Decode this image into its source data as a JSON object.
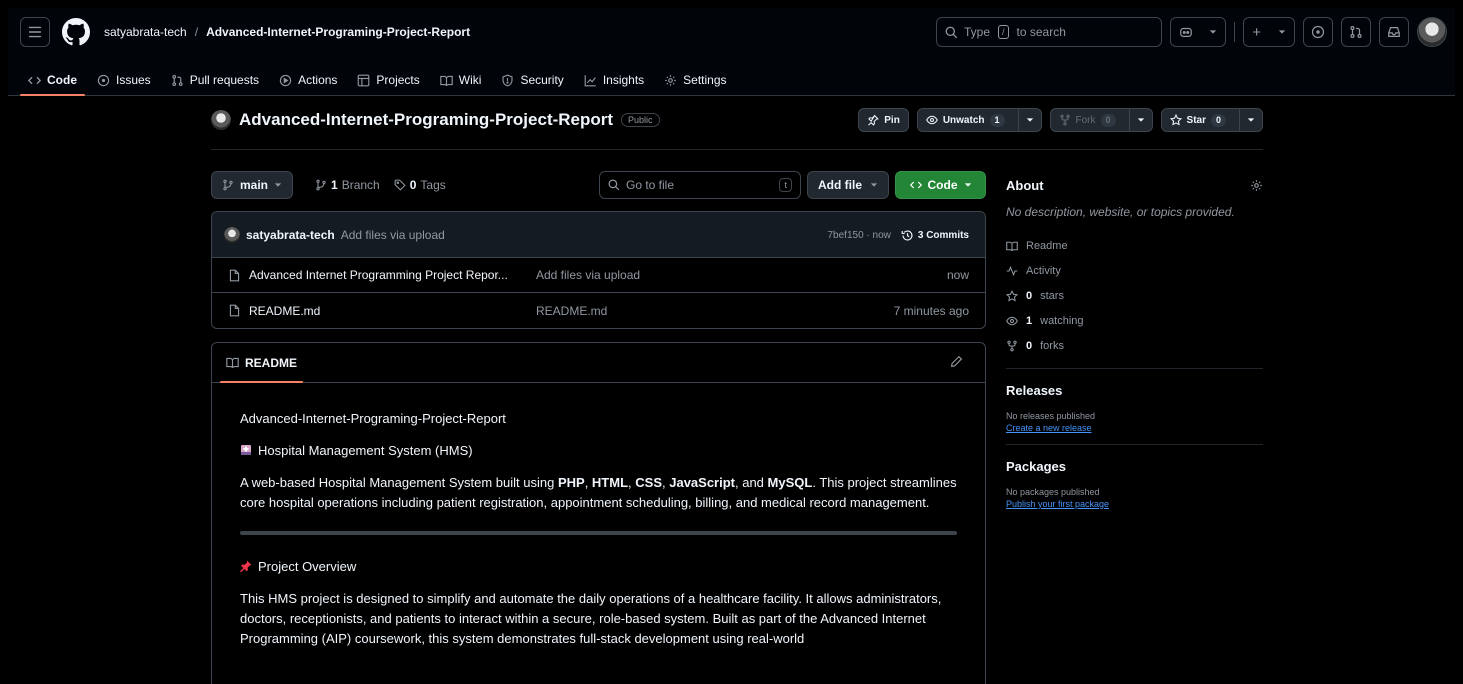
{
  "header": {
    "owner": "satyabrata-tech",
    "separator": "/",
    "repo": "Advanced-Internet-Programing-Project-Report",
    "search_prefix": "Type",
    "search_key": "/",
    "search_suffix": "to search",
    "plus_label": "+"
  },
  "nav_tabs": [
    {
      "label": "Code",
      "icon": "code-icon",
      "active": true
    },
    {
      "label": "Issues",
      "icon": "issue-icon"
    },
    {
      "label": "Pull requests",
      "icon": "pull-request-icon"
    },
    {
      "label": "Actions",
      "icon": "play-icon"
    },
    {
      "label": "Projects",
      "icon": "table-icon"
    },
    {
      "label": "Wiki",
      "icon": "book-icon"
    },
    {
      "label": "Security",
      "icon": "shield-icon"
    },
    {
      "label": "Insights",
      "icon": "graph-icon"
    },
    {
      "label": "Settings",
      "icon": "gear-icon"
    }
  ],
  "repo": {
    "name": "Advanced-Internet-Programing-Project-Report",
    "visibility": "Public",
    "pin_label": "Pin",
    "watch_label": "Unwatch",
    "watch_count": "1",
    "fork_label": "Fork",
    "fork_count": "0",
    "star_label": "Star",
    "star_count": "0"
  },
  "file_nav": {
    "branch": "main",
    "branch_count": "1",
    "branch_word": "Branch",
    "tag_count": "0",
    "tag_word": "Tags",
    "goto_placeholder": "Go to file",
    "goto_key": "t",
    "add_file_label": "Add file",
    "code_label": "Code"
  },
  "commit": {
    "author": "satyabrata-tech",
    "message": "Add files via upload",
    "hash_time": "7bef150 · now",
    "commits_label": "3 Commits"
  },
  "files": [
    {
      "name": "Advanced Internet Programming Project Repor...",
      "message": "Add files via upload",
      "date": "now"
    },
    {
      "name": "README.md",
      "message": "README.md",
      "date": "7 minutes ago"
    }
  ],
  "readme": {
    "tab_label": "README",
    "title": "Advanced-Internet-Programing-Project-Report",
    "hms_heading": "Hospital Management System (HMS)",
    "intro_1": "A web-based Hospital Management System built using ",
    "tech_php": "PHP",
    "comma1": ", ",
    "tech_html": "HTML",
    "comma2": ", ",
    "tech_css": "CSS",
    "comma3": ", ",
    "tech_js": "JavaScript",
    "and": ", and ",
    "tech_mysql": "MySQL",
    "intro_2": ". This project streamlines core hospital operations including patient registration, appointment scheduling, billing, and medical record management.",
    "overview_heading": "Project Overview",
    "overview_text": "This HMS project is designed to simplify and automate the daily operations of a healthcare facility. It allows administrators, doctors, receptionists, and patients to interact within a secure, role-based system. Built as part of the Advanced Internet Programming (AIP) coursework, this system demonstrates full-stack development using real-world"
  },
  "about": {
    "title": "About",
    "description": "No description, website, or topics provided.",
    "readme_label": "Readme",
    "activity_label": "Activity",
    "stars_count": "0",
    "stars_word": "stars",
    "watching_count": "1",
    "watching_word": "watching",
    "forks_count": "0",
    "forks_word": "forks"
  },
  "releases": {
    "title": "Releases",
    "empty": "No releases published",
    "link": "Create a new release"
  },
  "packages": {
    "title": "Packages",
    "empty": "No packages published",
    "link": "Publish your first package"
  },
  "colors": {
    "accent_underline": "#f78166",
    "code_button": "#238636",
    "link": "#4493f8"
  }
}
